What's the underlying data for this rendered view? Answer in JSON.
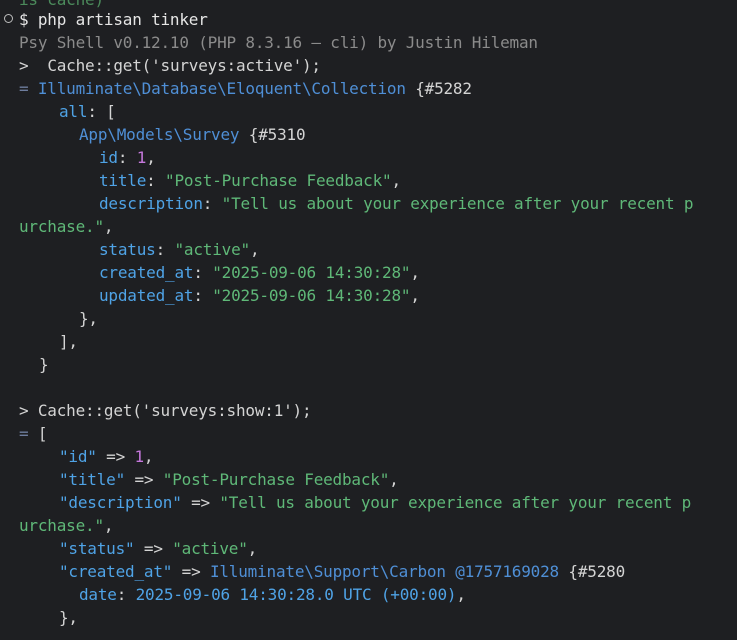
{
  "terminal": {
    "prev_cut": "is cache)",
    "cmd_prompt": "$ ",
    "cmd": "php artisan tinker",
    "banner": "Psy Shell v0.12.10 (PHP 8.3.16 — cli) by Justin Hileman",
    "q1_prompt": ">  ",
    "q1": "Cache::get('surveys:active');",
    "r1_eq": "= ",
    "r1_class": "Illuminate\\Database\\Eloquent\\Collection",
    "r1_id": " {#5282",
    "all_key": "all",
    "all_open": ": [",
    "model_class": "App\\Models\\Survey",
    "model_id": " {#5310",
    "f_id_key": "id",
    "f_id_val": "1",
    "f_title_key": "title",
    "f_title_val": "\"Post-Purchase Feedback\"",
    "f_desc_key": "description",
    "f_desc_val_1": "\"Tell us about your experience after your recent p",
    "f_desc_val_2": "urchase.\"",
    "f_status_key": "status",
    "f_status_val": "\"active\"",
    "f_created_key": "created_at",
    "f_created_val": "\"2025-09-06 14:30:28\"",
    "f_updated_key": "updated_at",
    "f_updated_val": "\"2025-09-06 14:30:28\"",
    "close_obj": "},",
    "close_arr": "],",
    "close_coll": "}",
    "q2_prompt": "> ",
    "q2": "Cache::get('surveys:show:1');",
    "r2_open": "[",
    "a_id_key": "\"id\"",
    "a_id_val": "1",
    "a_title_key": "\"title\"",
    "a_title_val": "\"Post-Purchase Feedback\"",
    "a_desc_key": "\"description\"",
    "a_desc_val_1": "\"Tell us about your experience after your recent p",
    "a_desc_val_2": "urchase.\"",
    "a_status_key": "\"status\"",
    "a_status_val": "\"active\"",
    "a_created_key": "\"created_at\"",
    "a_created_class": "Illuminate\\Support\\Carbon",
    "a_created_ts": " @1757169028",
    "a_created_id": " {#5280",
    "a_date_key": "date",
    "a_date_val": "2025-09-06 14:30:28.0 UTC (+00:00)",
    "a_close": "},"
  }
}
